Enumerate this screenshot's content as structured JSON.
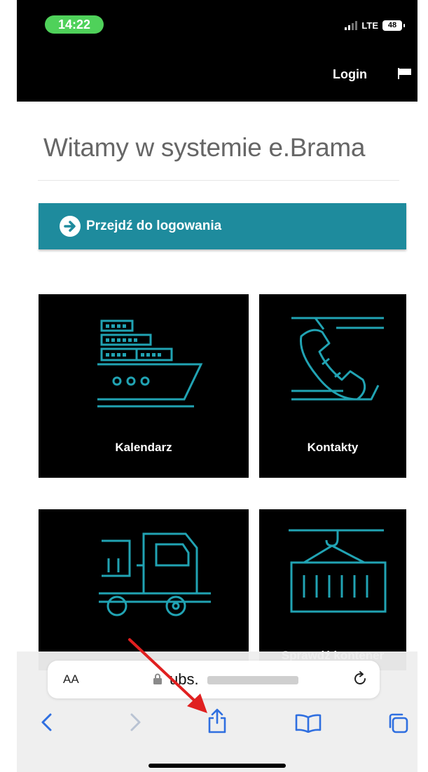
{
  "status_bar": {
    "time": "14:22",
    "network": "LTE",
    "battery": "48"
  },
  "header": {
    "login_label": "Login",
    "flag_icon": "flag-icon"
  },
  "main": {
    "welcome_title": "Witamy w systemie e.Brama",
    "cta_label": "Przejdź do logowania",
    "cta_icon": "arrow-right-circle-icon"
  },
  "tiles": [
    {
      "label": "Kalendarz",
      "icon": "ship-icon"
    },
    {
      "label": "Kontakty",
      "icon": "phone-icon"
    },
    {
      "label": "",
      "icon": "truck-icon"
    },
    {
      "label": "Sprawdź kontener",
      "icon": "container-crane-icon"
    }
  ],
  "safari": {
    "text_size_label": "AA",
    "url_visible": "ubs.",
    "icons": [
      "reload-icon",
      "back-icon",
      "forward-icon",
      "share-icon",
      "bookmarks-icon",
      "tabs-icon"
    ]
  },
  "colors": {
    "accent": "#1e8b9d",
    "tile_icon": "#21a3b3",
    "annotation_arrow": "#e02020",
    "status_green": "#4fd15a"
  }
}
